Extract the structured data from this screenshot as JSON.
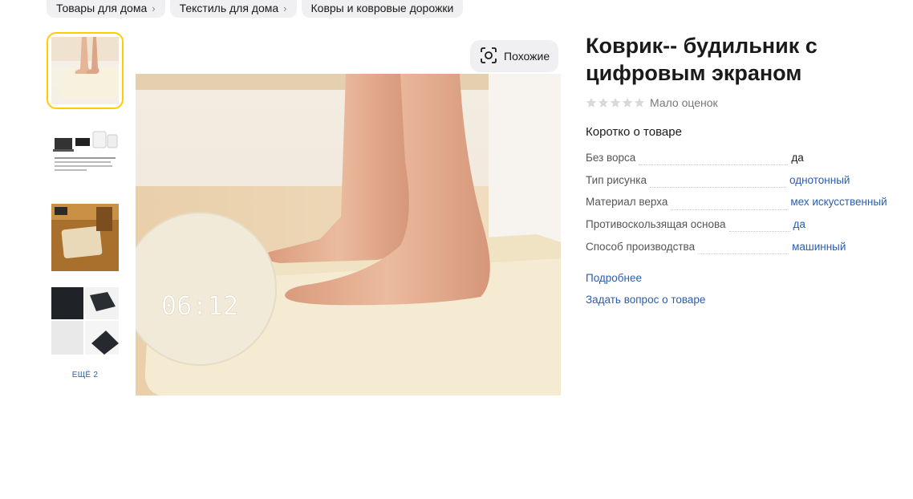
{
  "breadcrumbs": [
    {
      "label": "Товары для дома"
    },
    {
      "label": "Текстиль для дома"
    },
    {
      "label": "Ковры и ковровые дорожки"
    }
  ],
  "gallery": {
    "more_label": "ЕЩЁ 2",
    "similar_label": "Похожие",
    "clock_display": "06:12"
  },
  "product": {
    "title": "Коврик-- будильник с цифровым экраном",
    "rating_text": "Мало оценок",
    "stars_filled": 0,
    "stars_total": 5,
    "summary_title": "Коротко о товаре",
    "specs": [
      {
        "name": "Без ворса",
        "value": "да",
        "value_is_link": false
      },
      {
        "name": "Тип рисунка",
        "value": "однотонный",
        "value_is_link": true
      },
      {
        "name": "Материал верха",
        "value": "мех искусственный",
        "value_is_link": true
      },
      {
        "name": "Противоскользящая основа",
        "value": "да",
        "value_is_link": true
      },
      {
        "name": "Способ производства",
        "value": "машинный",
        "value_is_link": true
      }
    ],
    "more_details": "Подробнее",
    "ask_question": "Задать вопрос о товаре"
  },
  "colors": {
    "accent_yellow": "#ffcc00",
    "link_blue": "#2b5db0",
    "chip_bg": "#f0f0f2",
    "star_empty": "#d9d9d9"
  }
}
